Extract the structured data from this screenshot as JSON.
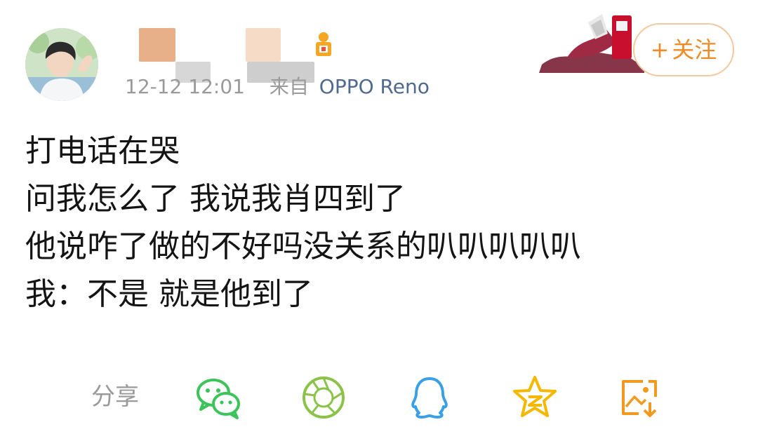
{
  "post": {
    "timestamp": "12-12 12:01",
    "source_prefix": "来自",
    "source_device": "OPPO Reno",
    "follow_label": "关注",
    "follow_plus": "+",
    "lines": [
      "打电话在哭",
      "问我怎么了 我说我肖四到了",
      "他说咋了做的不好吗没关系的叭叭叭叭叭",
      "我：不是 就是他到了"
    ]
  },
  "share": {
    "label": "分享",
    "targets": [
      "wechat-icon",
      "moments-icon",
      "qq-icon",
      "qzone-icon",
      "save-image-icon"
    ]
  },
  "colors": {
    "accent": "#f08a24",
    "follow_border": "#f3c89e",
    "meta_gray": "#9a9a9a",
    "device_blue": "#506a8f",
    "wechat_green": "#3cc35a",
    "moments_green": "#8bc34a",
    "qq_blue": "#3aa0e6",
    "qzone_yellow": "#f5b800",
    "save_orange": "#f29a1f"
  }
}
